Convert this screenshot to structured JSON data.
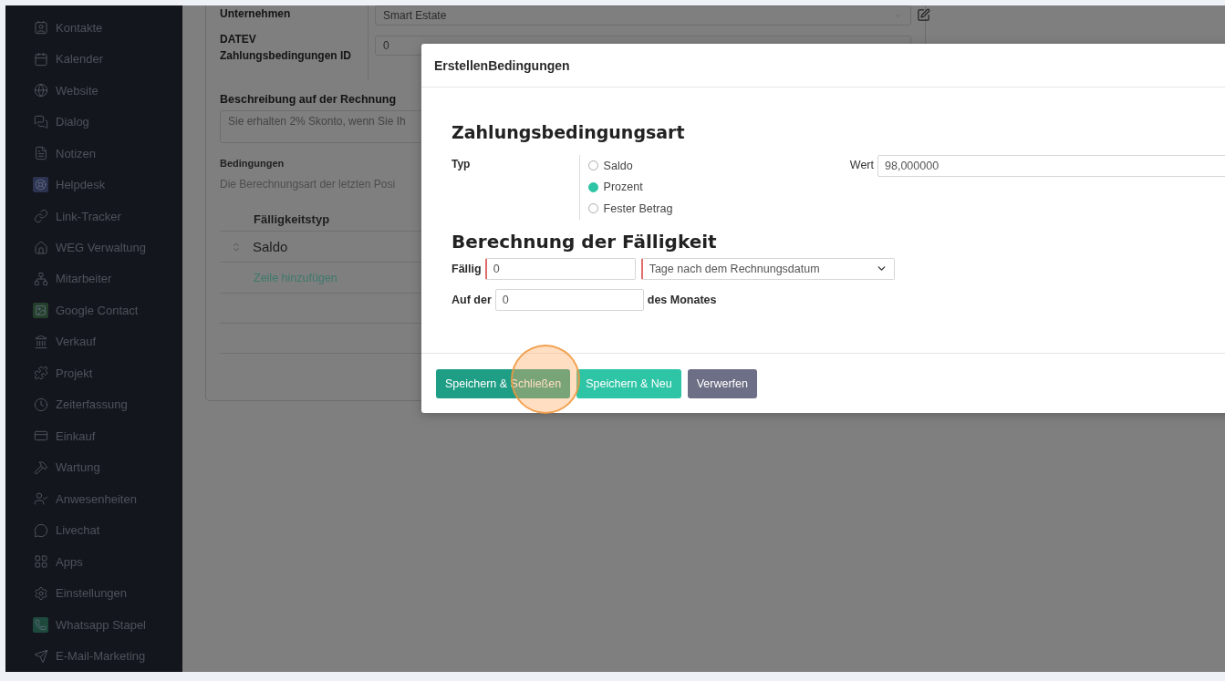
{
  "sidebar": {
    "items": [
      {
        "label": "Kontakte"
      },
      {
        "label": "Kalender"
      },
      {
        "label": "Website"
      },
      {
        "label": "Dialog"
      },
      {
        "label": "Notizen"
      },
      {
        "label": "Helpdesk"
      },
      {
        "label": "Link-Tracker"
      },
      {
        "label": "WEG Verwaltung"
      },
      {
        "label": "Mitarbeiter"
      },
      {
        "label": "Google Contact"
      },
      {
        "label": "Verkauf"
      },
      {
        "label": "Projekt"
      },
      {
        "label": "Zeiterfassung"
      },
      {
        "label": "Einkauf"
      },
      {
        "label": "Wartung"
      },
      {
        "label": "Anwesenheiten"
      },
      {
        "label": "Livechat"
      },
      {
        "label": "Apps"
      },
      {
        "label": "Einstellungen"
      },
      {
        "label": "Whatsapp Stapel"
      },
      {
        "label": "E-Mail-Marketing"
      }
    ]
  },
  "background_form": {
    "fields": [
      {
        "label": "Unternehmen",
        "value": "Smart Estate",
        "kind": "select"
      },
      {
        "label": "DATEV Zahlungsbedingungen ID",
        "value": "0",
        "kind": "input"
      }
    ],
    "description": {
      "label": "Beschreibung auf der Rechnung",
      "value": "Sie erhalten 2% Skonto, wenn Sie Ih"
    },
    "conditions": {
      "label": "Bedingungen",
      "hint": "Die Berechnungsart der letzten Posi",
      "table": {
        "columns": [
          "Fälligkeitstyp"
        ],
        "rows": [
          {
            "cells": [
              "Saldo"
            ]
          }
        ],
        "add_row": "Zeile hinzufügen"
      }
    }
  },
  "dialog": {
    "title": "ErstellenBedingungen",
    "section_1": {
      "heading": "Zahlungsbedingungsart",
      "type_label": "Typ",
      "options": [
        {
          "label": "Saldo",
          "selected": false
        },
        {
          "label": "Prozent",
          "selected": true
        },
        {
          "label": "Fester Betrag",
          "selected": false
        }
      ],
      "value_label": "Wert",
      "value": "98,000000"
    },
    "section_2": {
      "heading": "Berechnung der Fälligkeit",
      "due_label": "Fällig",
      "due_value": "0",
      "due_unit": "Tage nach dem Rechnungsdatum",
      "on_label": "Auf der",
      "on_value": "0",
      "on_suffix": "des Monates"
    },
    "buttons": [
      {
        "label": "Speichern & Schließen",
        "kind": "primary"
      },
      {
        "label": "Speichern & Neu",
        "kind": "secondary"
      },
      {
        "label": "Verwerfen",
        "kind": "discard"
      }
    ]
  }
}
